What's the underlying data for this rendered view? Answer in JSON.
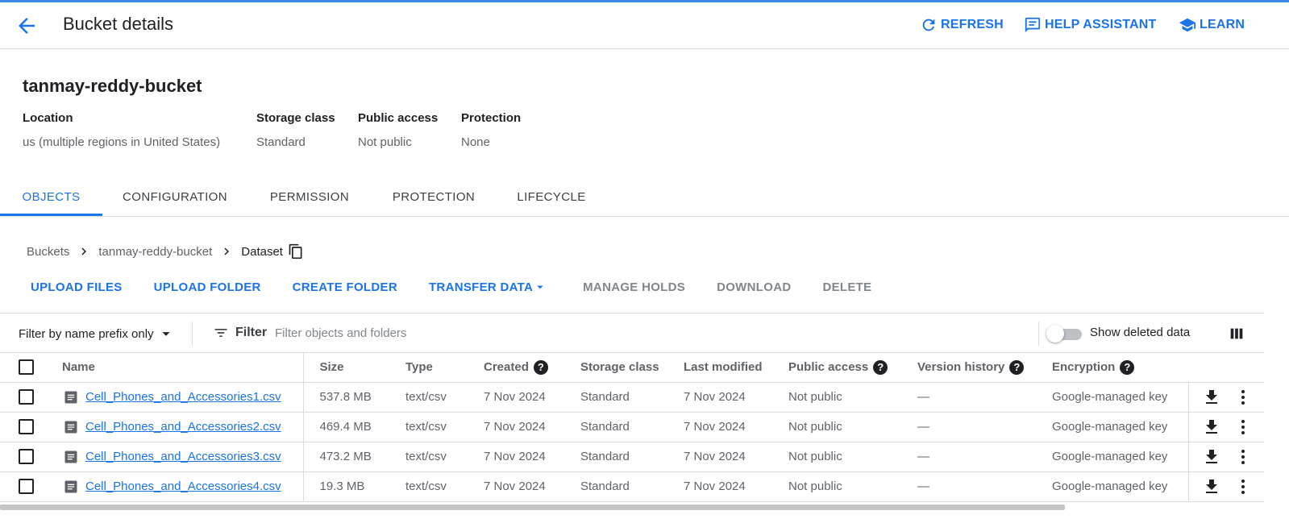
{
  "header": {
    "title": "Bucket details",
    "refresh_label": "REFRESH",
    "help_label": "HELP ASSISTANT",
    "learn_label": "LEARN"
  },
  "bucket": {
    "name": "tanmay-reddy-bucket",
    "meta": [
      {
        "key": "Location",
        "value": "us (multiple regions in United States)"
      },
      {
        "key": "Storage class",
        "value": "Standard"
      },
      {
        "key": "Public access",
        "value": "Not public"
      },
      {
        "key": "Protection",
        "value": "None"
      }
    ]
  },
  "tabs": [
    "OBJECTS",
    "CONFIGURATION",
    "PERMISSION",
    "PROTECTION",
    "LIFECYCLE"
  ],
  "active_tab": "OBJECTS",
  "breadcrumb": [
    "Buckets",
    "tanmay-reddy-bucket",
    "Dataset"
  ],
  "actions": {
    "upload_files": "UPLOAD FILES",
    "upload_folder": "UPLOAD FOLDER",
    "create_folder": "CREATE FOLDER",
    "transfer_data": "TRANSFER DATA",
    "manage_holds": "MANAGE HOLDS",
    "download": "DOWNLOAD",
    "delete": "DELETE"
  },
  "filter": {
    "select_value": "Filter by name prefix only",
    "label": "Filter",
    "placeholder": "Filter objects and folders",
    "show_deleted_label": "Show deleted data",
    "show_deleted_on": false
  },
  "table": {
    "columns": [
      "Name",
      "Size",
      "Type",
      "Created",
      "Storage class",
      "Last modified",
      "Public access",
      "Version history",
      "Encryption"
    ],
    "rows": [
      {
        "name": "Cell_Phones_and_Accessories1.csv",
        "size": "537.8 MB",
        "type": "text/csv",
        "created": "7 Nov 2024",
        "storage_class": "Standard",
        "modified": "7 Nov 2024",
        "public_access": "Not public",
        "version_history": "—",
        "encryption": "Google-managed key"
      },
      {
        "name": "Cell_Phones_and_Accessories2.csv",
        "size": "469.4 MB",
        "type": "text/csv",
        "created": "7 Nov 2024",
        "storage_class": "Standard",
        "modified": "7 Nov 2024",
        "public_access": "Not public",
        "version_history": "—",
        "encryption": "Google-managed key"
      },
      {
        "name": "Cell_Phones_and_Accessories3.csv",
        "size": "473.2 MB",
        "type": "text/csv",
        "created": "7 Nov 2024",
        "storage_class": "Standard",
        "modified": "7 Nov 2024",
        "public_access": "Not public",
        "version_history": "—",
        "encryption": "Google-managed key"
      },
      {
        "name": "Cell_Phones_and_Accessories4.csv",
        "size": "19.3 MB",
        "type": "text/csv",
        "created": "7 Nov 2024",
        "storage_class": "Standard",
        "modified": "7 Nov 2024",
        "public_access": "Not public",
        "version_history": "—",
        "encryption": "Google-managed key"
      }
    ]
  },
  "colors": {
    "accent": "#1a73e8",
    "text": "#202124",
    "muted": "#5f6368",
    "divider": "#dadce0"
  },
  "icons": [
    "back-arrow-icon",
    "refresh-icon",
    "chat-icon",
    "school-cap-icon",
    "chevron-right-icon",
    "copy-icon",
    "dropdown-arrow-icon",
    "filter-lines-icon",
    "columns-icon",
    "file-icon",
    "help-icon",
    "download-icon",
    "more-vert-icon"
  ]
}
